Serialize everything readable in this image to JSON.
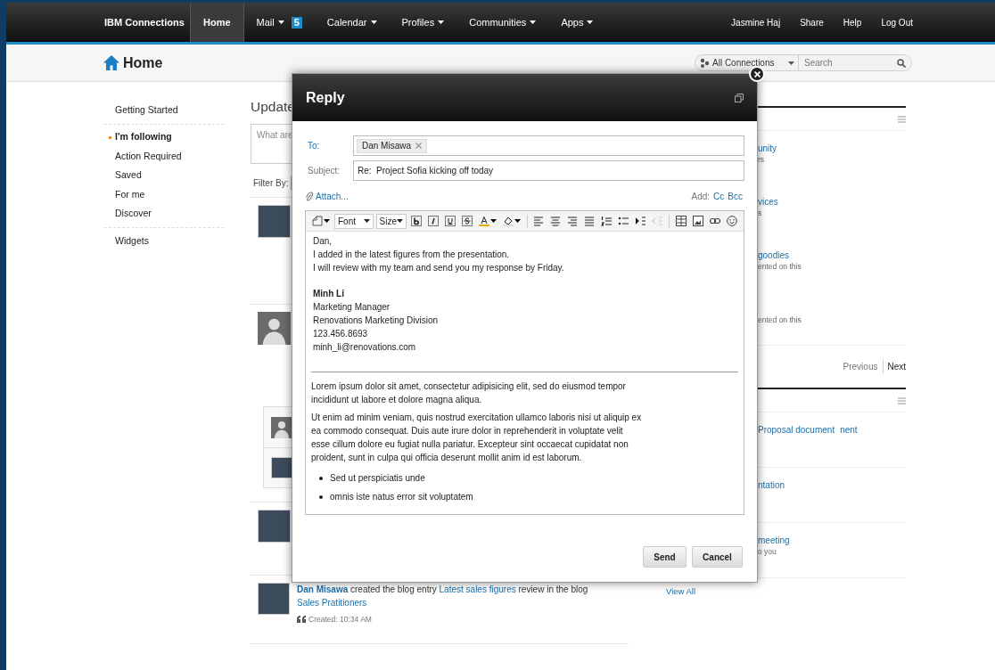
{
  "nav": {
    "brand": "IBM Connections",
    "items": [
      {
        "label": "Home",
        "selected": true,
        "menu": false
      },
      {
        "label": "Mail",
        "selected": false,
        "menu": true,
        "badge": "5"
      },
      {
        "label": "Calendar",
        "selected": false,
        "menu": true
      },
      {
        "label": "Profiles",
        "selected": false,
        "menu": true
      },
      {
        "label": "Communities",
        "selected": false,
        "menu": true
      },
      {
        "label": "Apps",
        "selected": false,
        "menu": true
      }
    ],
    "user_links": [
      "Jasmine Haj",
      "Share",
      "Help",
      "Log Out"
    ]
  },
  "header": {
    "title": "Home",
    "scope": "All Connections",
    "search_placeholder": "Search"
  },
  "sidebar": {
    "groups": [
      [
        {
          "label": "Getting Started",
          "selected": false
        }
      ],
      [
        {
          "label": "I'm following",
          "selected": true
        },
        {
          "label": "Action Required",
          "selected": false
        },
        {
          "label": "Saved",
          "selected": false
        },
        {
          "label": "For me",
          "selected": false
        },
        {
          "label": "Discover",
          "selected": false
        }
      ],
      [
        {
          "label": "Widgets",
          "selected": false
        }
      ]
    ]
  },
  "feed": {
    "heading": "Update",
    "status_placeholder": "What are",
    "filter_label": "Filter By:",
    "entries": [
      {
        "kind": "photo"
      },
      {
        "kind": "silhouette",
        "replies": [
          {
            "kind": "silhouette"
          },
          {
            "kind": "photo"
          }
        ]
      },
      {
        "kind": "photo"
      },
      {
        "kind": "photo",
        "author": "Dan Misawa",
        "action": "created the blog entry",
        "entry": "Latest sales figures",
        "after": "review in the blog",
        "blog": "Sales Pratitioners",
        "created": "Created: 10:34 AM"
      }
    ]
  },
  "right": {
    "panels": [
      {
        "items": [
          {
            "link": "unity",
            "meta": "rs"
          },
          {
            "link": "vices",
            "meta": "s"
          },
          {
            "link": "goodies",
            "meta": "ented on this"
          },
          {
            "meta": "ented on this"
          }
        ],
        "pager": {
          "previous": "Previous",
          "next": "Next"
        }
      },
      {
        "items": [
          {
            "link": "Proposal document",
            "link2": "nent"
          },
          {
            "link": "ntation"
          },
          {
            "link": "meeting",
            "meta": "o you"
          }
        ]
      }
    ],
    "view_all": "View All"
  },
  "dialog": {
    "title": "Reply",
    "to_label": "To:",
    "recipients": [
      "Dan Misawa"
    ],
    "subject_label": "Subject:",
    "subject": "Re:  Project Sofia kicking off today",
    "attach": "Attach...",
    "add_label": "Add:",
    "cc": "Cc",
    "bcc": "Bcc",
    "toolbar": {
      "font": "Font",
      "size": "Size"
    },
    "message": {
      "lines": [
        "Dan,",
        "I added in the latest figures from the presentation.",
        "I will review with my team and send you my response by Friday."
      ],
      "signature_name": "Minh Li",
      "signature_lines": [
        "Marketing Manager",
        "Renovations Marketing Division",
        "123.456.8693",
        "minh_li@renovations.com"
      ],
      "quoted_paragraphs": [
        "Lorem ipsum dolor sit amet, consectetur adipisicing elit, sed do eiusmod tempor incididunt ut labore et dolore magna aliqua.",
        "Ut enim ad minim veniam, quis nostrud exercitation ullamco laboris nisi ut aliquip ex ea commodo consequat. Duis aute irure dolor in reprehenderit in voluptate velit esse cillum dolore eu fugiat nulla pariatur. Excepteur sint occaecat cupidatat non proident, sunt in culpa qui officia deserunt mollit anim id est laborum."
      ],
      "quoted_bullets": [
        "Sed ut perspiciatis unde",
        "omnis iste natus error sit voluptatem"
      ]
    },
    "buttons": [
      {
        "kind": "primary",
        "label": "Send"
      },
      {
        "kind": "secondary",
        "label": "Cancel"
      }
    ]
  }
}
